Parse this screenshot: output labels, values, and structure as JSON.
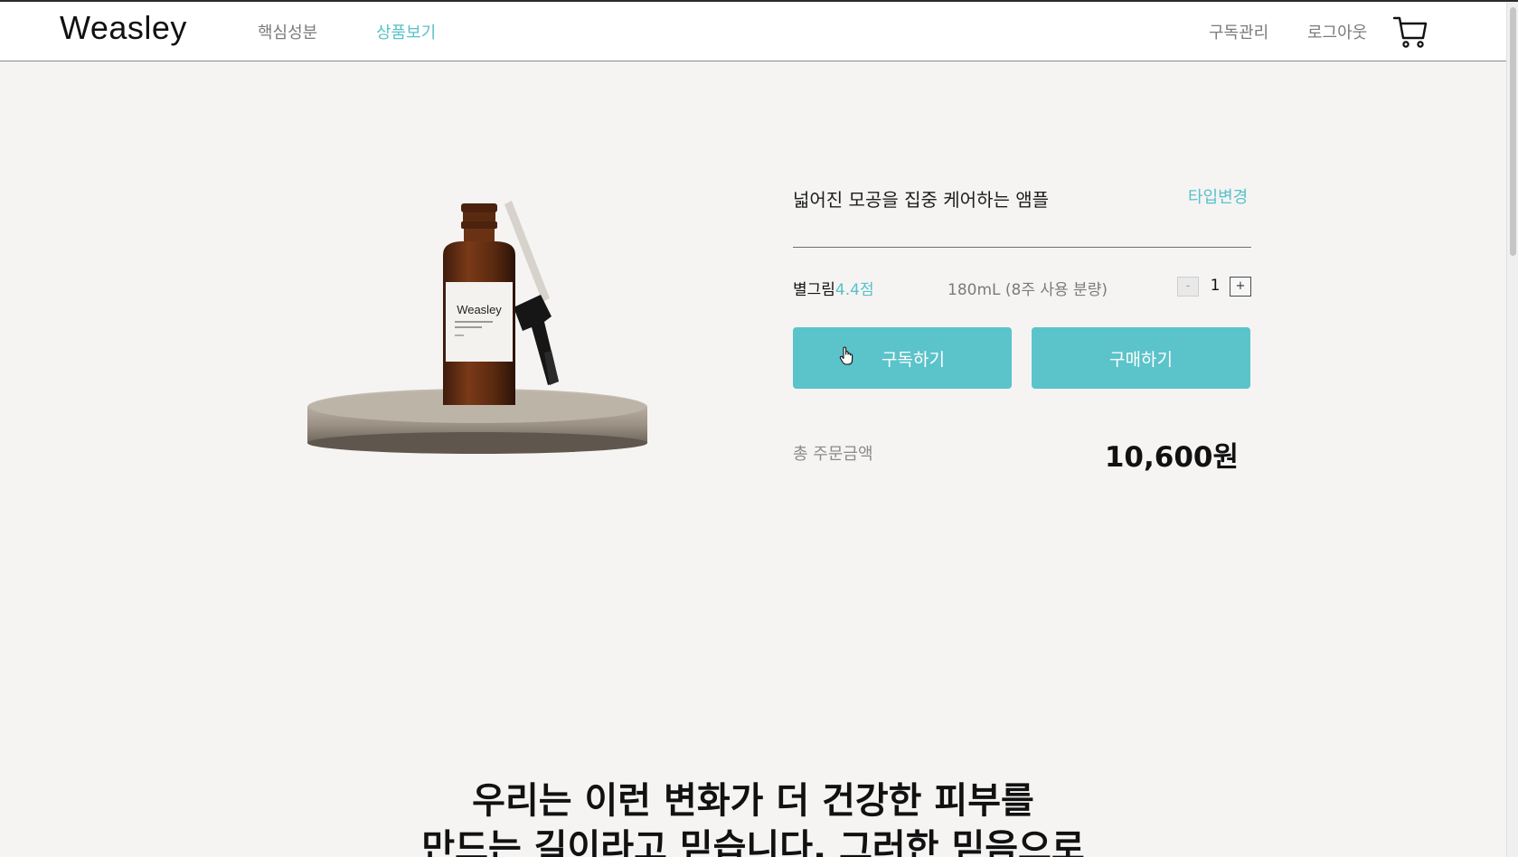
{
  "header": {
    "logo": "Weasley",
    "nav": [
      {
        "label": "핵심성분"
      },
      {
        "label": "상품보기"
      }
    ],
    "right_nav": [
      {
        "label": "구독관리"
      },
      {
        "label": "로그아웃"
      }
    ],
    "cart_icon": "cart-icon"
  },
  "product": {
    "title": "넓어진 모공을 집중 케어하는 앰플",
    "type_change": "타입변경",
    "rating_prefix": "별그림",
    "rating_score": "4.4점",
    "volume": "180mL (8주 사용 분량)",
    "quantity": {
      "minus_label": "-",
      "value": "1",
      "plus_label": "+"
    },
    "image_brand": "Weasley"
  },
  "actions": {
    "subscribe_label": "구독하기",
    "buy_label": "구매하기"
  },
  "order": {
    "total_label": "총 주문금액",
    "total_value": "10,600원"
  },
  "slogan": {
    "line1": "우리는 이런 변화가 더 건강한 피부를",
    "line2": "만드는 길이라고 믿습니다. 그러한 믿음으로"
  },
  "colors": {
    "accent": "#5bc3ca",
    "background": "#f5f4f3",
    "header_bg": "#ffffff"
  }
}
